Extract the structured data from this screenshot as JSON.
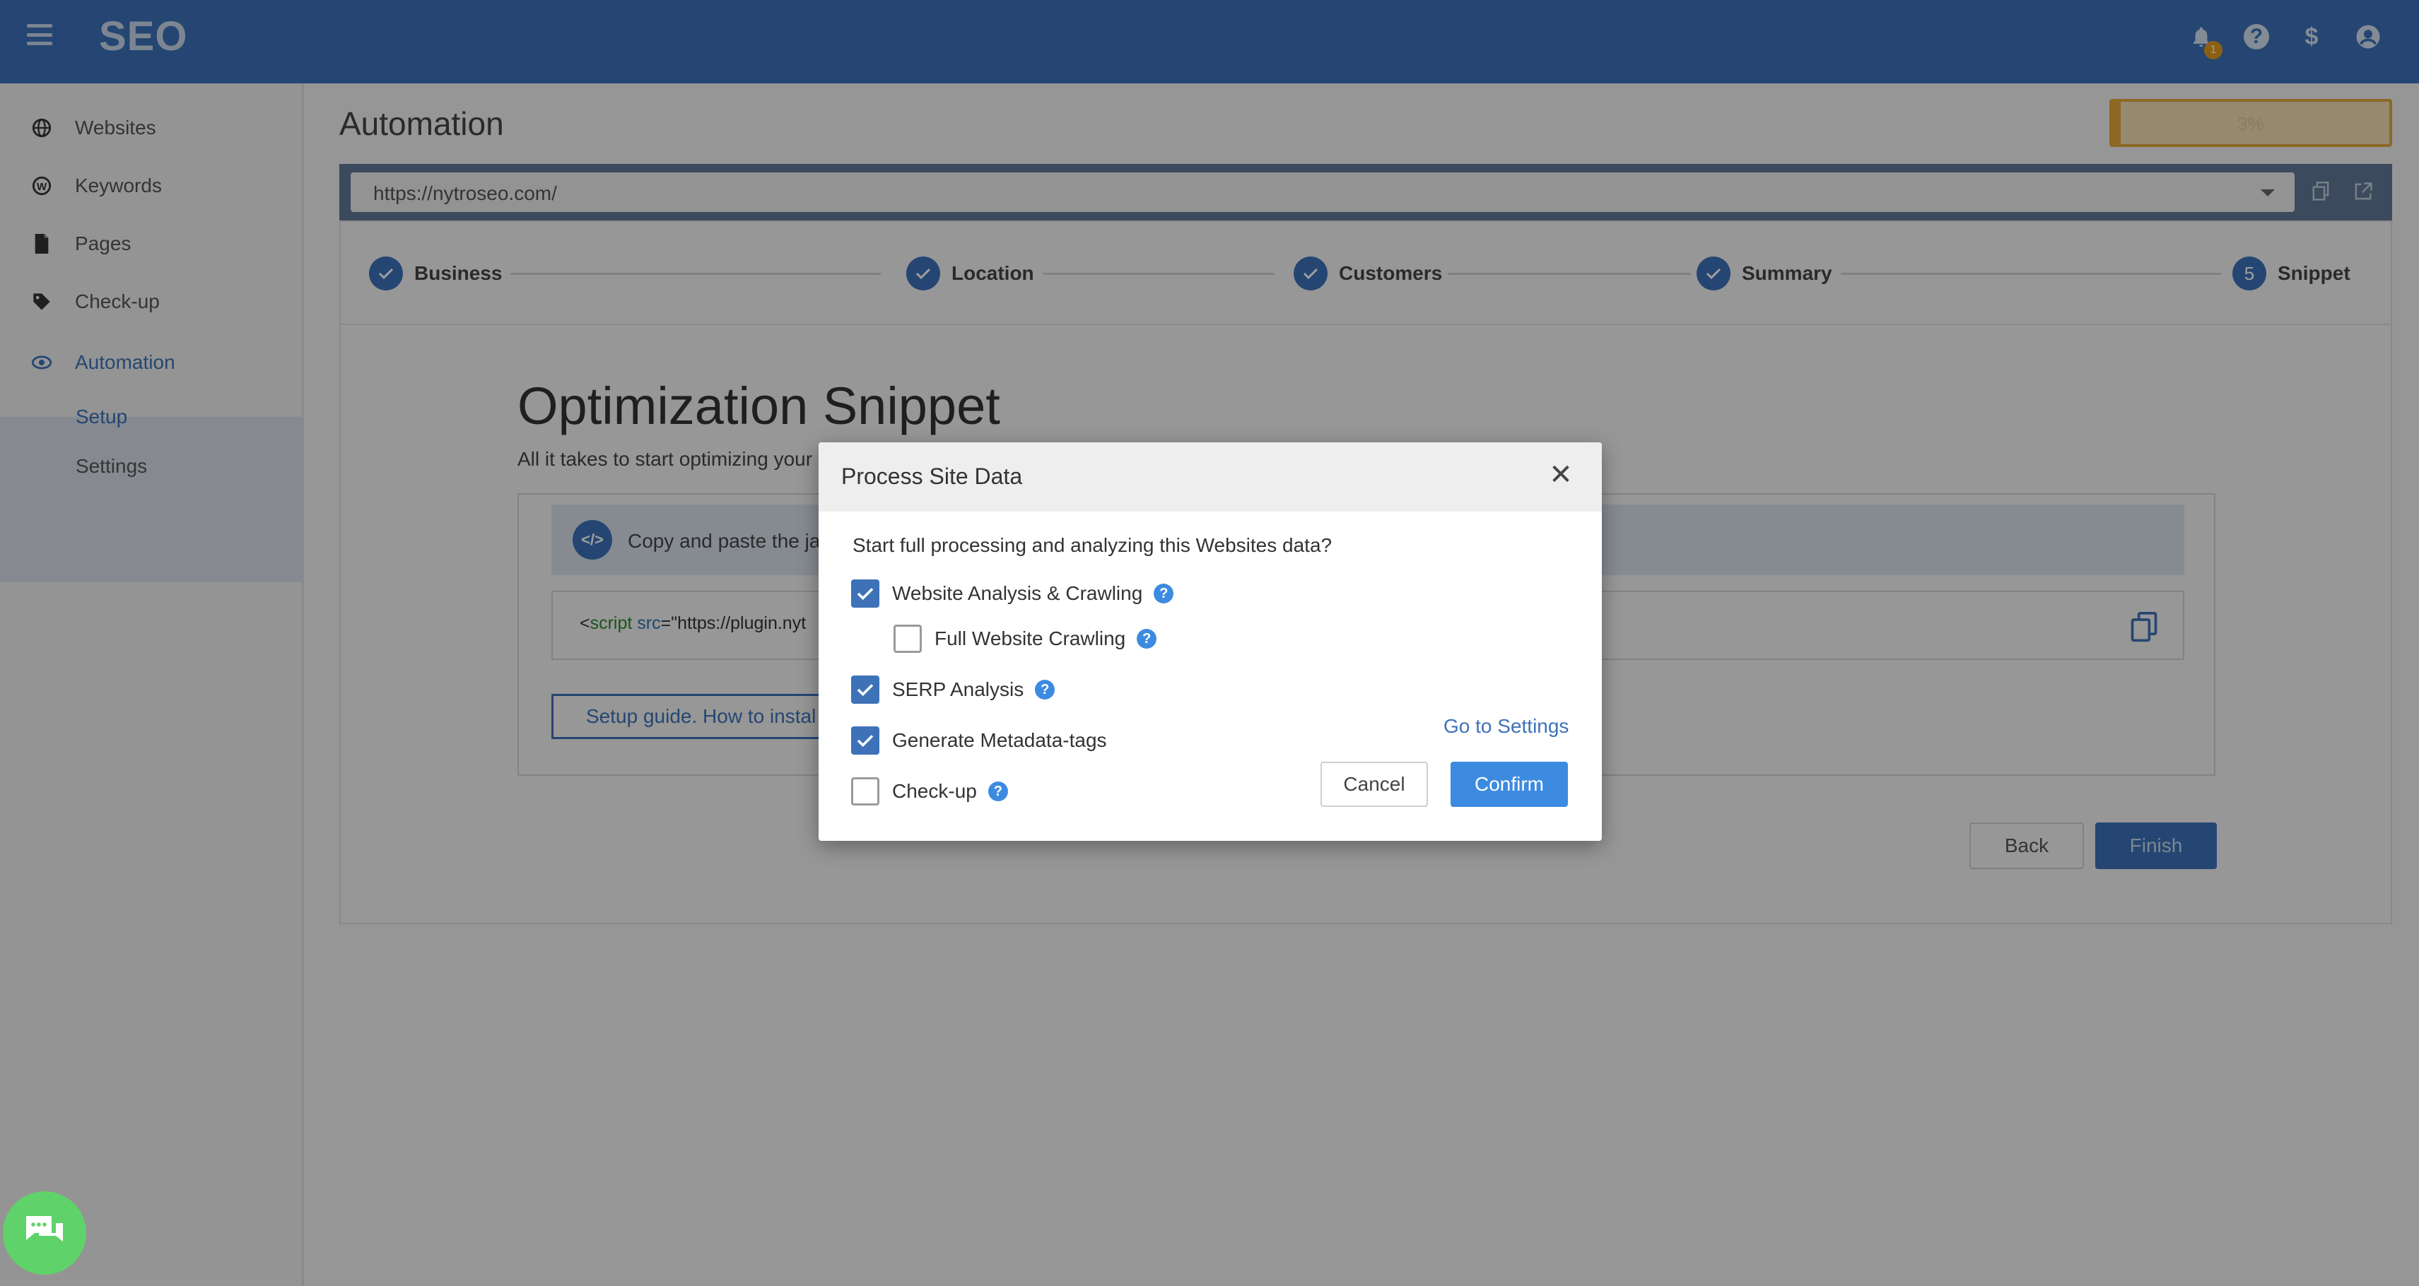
{
  "header": {
    "brand": "SEO",
    "notification_count": "1",
    "icons": [
      "hamburger-icon",
      "bell-icon",
      "help-icon",
      "dollar-icon",
      "account-icon"
    ]
  },
  "sidebar": {
    "items": [
      {
        "label": "Websites",
        "icon": "globe-icon"
      },
      {
        "label": "Keywords",
        "icon": "wordpress-icon"
      },
      {
        "label": "Pages",
        "icon": "file-icon"
      },
      {
        "label": "Check-up",
        "icon": "tag-icon"
      },
      {
        "label": "Automation",
        "icon": "eye-gear-icon"
      }
    ],
    "sub_items": [
      {
        "label": "Setup"
      },
      {
        "label": "Settings"
      }
    ]
  },
  "main": {
    "title": "Automation",
    "progress": {
      "label": "3%",
      "percent": 3
    },
    "url": "https://nytroseo.com/",
    "steps": [
      {
        "label": "Business",
        "state": "done"
      },
      {
        "label": "Location",
        "state": "done"
      },
      {
        "label": "Customers",
        "state": "done"
      },
      {
        "label": "Summary",
        "state": "done"
      },
      {
        "label": "Snippet",
        "state": "current",
        "number": "5"
      }
    ],
    "snippet": {
      "title": "Optimization Snippet",
      "subtitle": "All it takes to start optimizing your",
      "info_text": "Copy and paste the ja",
      "code_open": "<",
      "code_tag": "script",
      "code_attr": "src",
      "code_rest": "=\"https://plugin.nyt",
      "guide_label": "Setup guide. How to instal"
    },
    "back_label": "Back",
    "finish_label": "Finish"
  },
  "modal": {
    "title": "Process Site Data",
    "question": "Start full processing and analyzing this Websites data?",
    "options": [
      {
        "label": "Website Analysis & Crawling",
        "checked": true,
        "help": true
      },
      {
        "label": "Full Website Crawling",
        "checked": false,
        "help": true
      },
      {
        "label": "SERP Analysis",
        "checked": true,
        "help": true
      },
      {
        "label": "Generate Metadata-tags",
        "checked": true,
        "help": false
      },
      {
        "label": "Check-up",
        "checked": false,
        "help": true
      }
    ],
    "settings_link": "Go to Settings",
    "cancel_label": "Cancel",
    "confirm_label": "Confirm"
  },
  "colors": {
    "primary": "#3d72b8",
    "accent_blue": "#3d8be0",
    "progress": "#e2a93a",
    "chat": "#5fd36a"
  }
}
